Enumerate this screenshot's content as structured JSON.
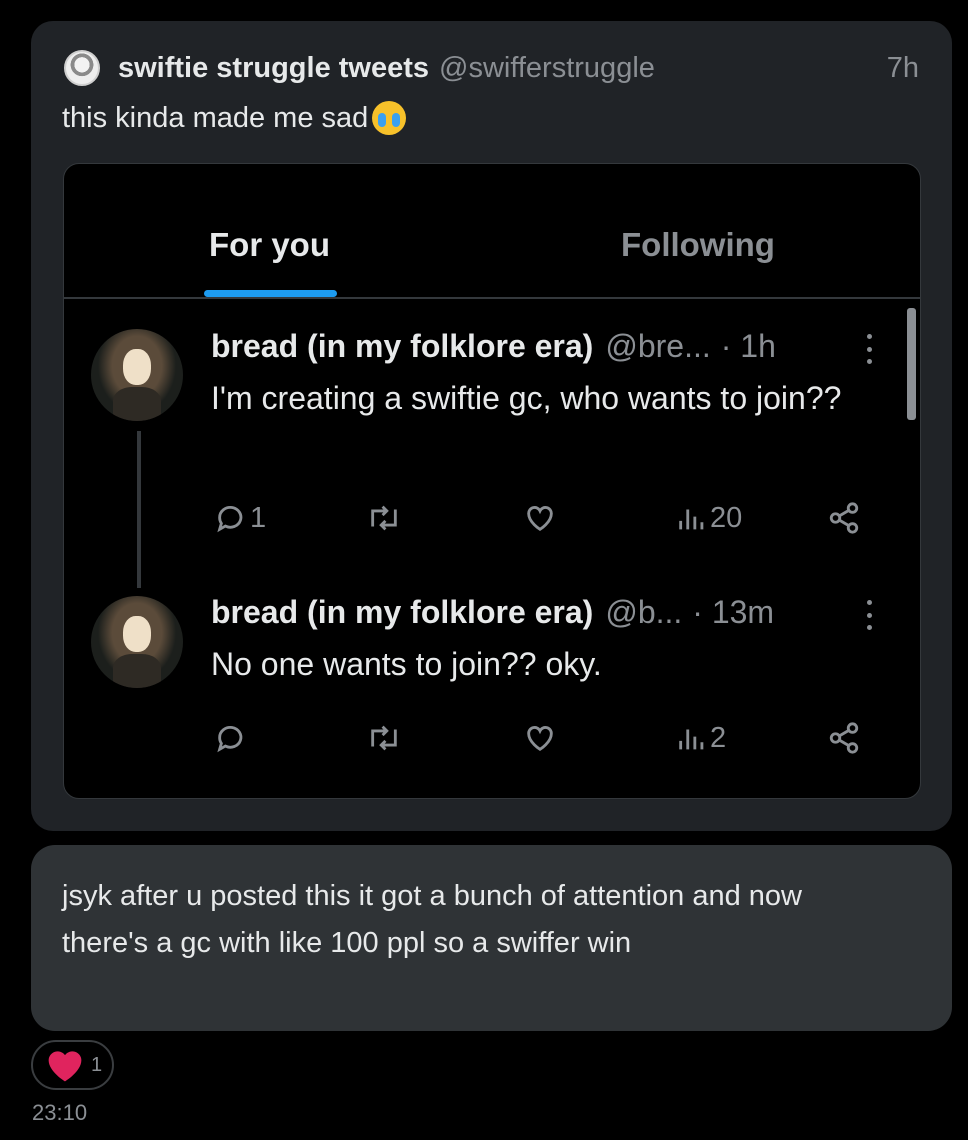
{
  "tweet": {
    "author_name": "swiftie struggle tweets",
    "author_handle": "@swifferstruggle",
    "time": "7h",
    "text": "this kinda made me sad",
    "emoji": "loudly-crying-face"
  },
  "embedded": {
    "tabs": [
      {
        "label": "For you",
        "active": true
      },
      {
        "label": "Following",
        "active": false
      }
    ],
    "posts": [
      {
        "name": "bread (in my folklore era)",
        "handle": "@bre...",
        "time": "· 1h",
        "text": "I'm creating a swiftie gc, who wants to join??",
        "replies": "1",
        "views": "20"
      },
      {
        "name": "bread (in my folklore era)",
        "handle": "@b...",
        "time": "· 13m",
        "text": "No one wants to join?? oky.",
        "replies": "",
        "views": "2"
      }
    ]
  },
  "reply": {
    "text": "jsyk after u posted this it got a bunch of attention and now there's a gc with like 100 ppl so a swiffer win"
  },
  "reaction": {
    "icon": "heart-icon",
    "color": "#e0245e",
    "count": "1"
  },
  "message_time": "23:10",
  "colors": {
    "background": "#000000",
    "card": "#202327",
    "bubble": "#2f3336",
    "accent": "#1d9bf0",
    "muted": "#8b8f94"
  }
}
